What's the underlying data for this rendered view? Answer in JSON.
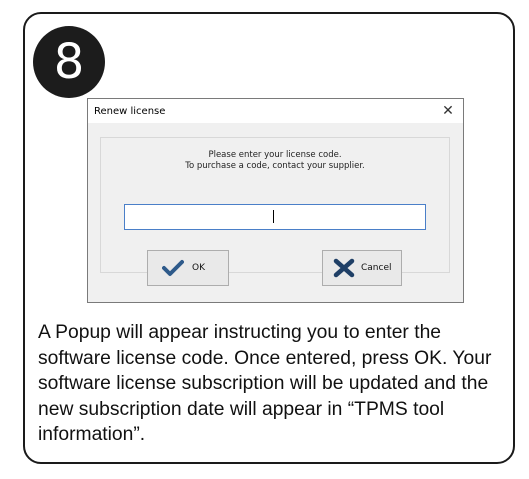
{
  "step": {
    "number": "8"
  },
  "dialog": {
    "title": "Renew license",
    "close_symbol": "✕",
    "message_line1": "Please enter your license code.",
    "message_line2": "To purchase a code, contact your supplier.",
    "license_input": {
      "value": ""
    },
    "ok_button": {
      "label": "OK",
      "icon": "checkmark-icon",
      "icon_color": "#2e5a8a"
    },
    "cancel_button": {
      "label": "Cancel",
      "icon": "cross-icon",
      "icon_color": "#1f3f66"
    },
    "input_border_color": "#4a7fc8"
  },
  "caption": {
    "text": "A Popup will appear instructing you to enter the software license code. Once entered, press OK. Your software license subscription will be updated and the new subscription date will appear in “TPMS tool information”."
  },
  "colors": {
    "badge_background": "#1c1c1c",
    "card_border": "#1a1a1a",
    "dialog_body": "#f0f0f0"
  }
}
